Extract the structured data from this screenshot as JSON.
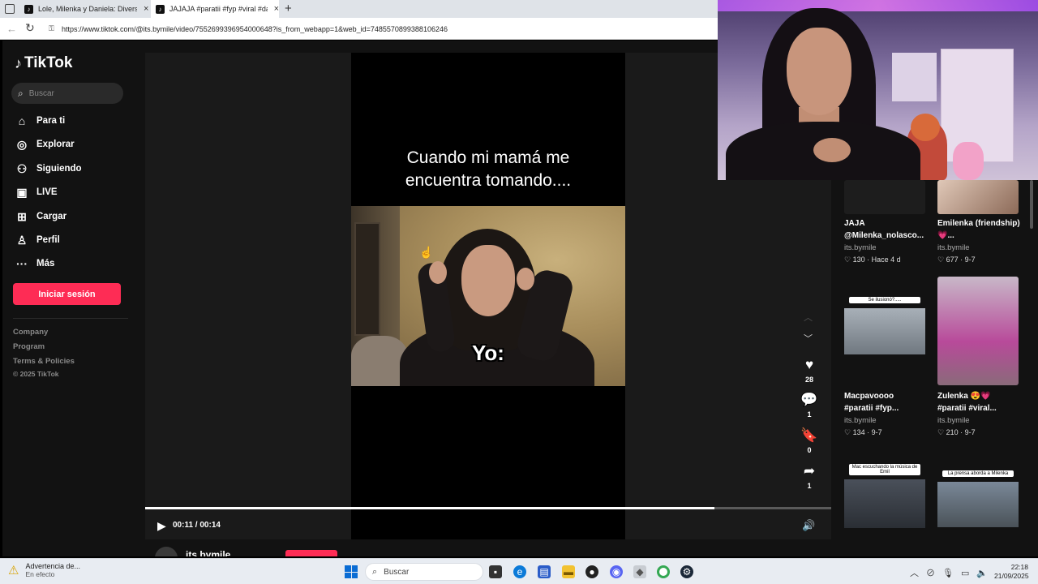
{
  "browser": {
    "tabs": [
      {
        "title": "Lole, Milenka y Daniela: Diversión",
        "close": "×"
      },
      {
        "title": "JAJAJA #paratii #fyp #viral #danie",
        "close": "×"
      }
    ],
    "new_tab": "+",
    "url": "https://www.tiktok.com/@its.bymile/video/7552699396954000648?is_from_webapp=1&web_id=7485570899388106246"
  },
  "sidebar": {
    "logo": "TikTok",
    "search_placeholder": "Buscar",
    "nav": [
      {
        "label": "Para ti",
        "icon": "home-icon",
        "glyph": "⌂"
      },
      {
        "label": "Explorar",
        "icon": "compass-icon",
        "glyph": "◎"
      },
      {
        "label": "Siguiendo",
        "icon": "following-icon",
        "glyph": "⚇"
      },
      {
        "label": "LIVE",
        "icon": "live-icon",
        "glyph": "▣"
      },
      {
        "label": "Cargar",
        "icon": "upload-icon",
        "glyph": "⊞"
      },
      {
        "label": "Perfil",
        "icon": "profile-icon",
        "glyph": "♙"
      },
      {
        "label": "Más",
        "icon": "more-icon",
        "glyph": "···"
      }
    ],
    "login": "Iniciar sesión",
    "footer": [
      "Company",
      "Program",
      "Terms & Policies"
    ],
    "copyright": "© 2025 TikTok"
  },
  "video": {
    "caption_line1": "Cuando mi mamá me",
    "caption_line2": "encuentra tomando....",
    "overlay_text": "Yo:",
    "time": "00:11 / 00:14",
    "progress": 0.83,
    "author": "its.bymile",
    "actions": {
      "likes": "28",
      "comments": "1",
      "saves": "0",
      "shares": "1"
    }
  },
  "related": [
    {
      "title1": "JAJA",
      "title2": "@Milenka_nolasco...",
      "author": "its.bymile",
      "likes": "130",
      "date": "Hace 4 d"
    },
    {
      "title1": "Emilenka (friendship)",
      "title2": "💗...",
      "author": "its.bymile",
      "likes": "677",
      "date": "9-7"
    },
    {
      "title1": "Macpavoooo",
      "title2": "#paratii #fyp...",
      "author": "its.bymile",
      "likes": "134",
      "date": "9-7",
      "thumb_label": "Se ilusionó?....."
    },
    {
      "title1": "Zulenka 😍💗",
      "title2": "#paratii #viral...",
      "author": "its.bymile",
      "likes": "210",
      "date": "9-7"
    },
    {
      "thumb_label": "Mac escuchando la música de Emil"
    },
    {
      "thumb_label": "La prensa aborda a Milenka"
    }
  ],
  "taskbar": {
    "warning_title": "Advertencia de...",
    "warning_sub": "En efecto",
    "search": "Buscar",
    "time": "22:18",
    "date": "21/09/2025"
  }
}
